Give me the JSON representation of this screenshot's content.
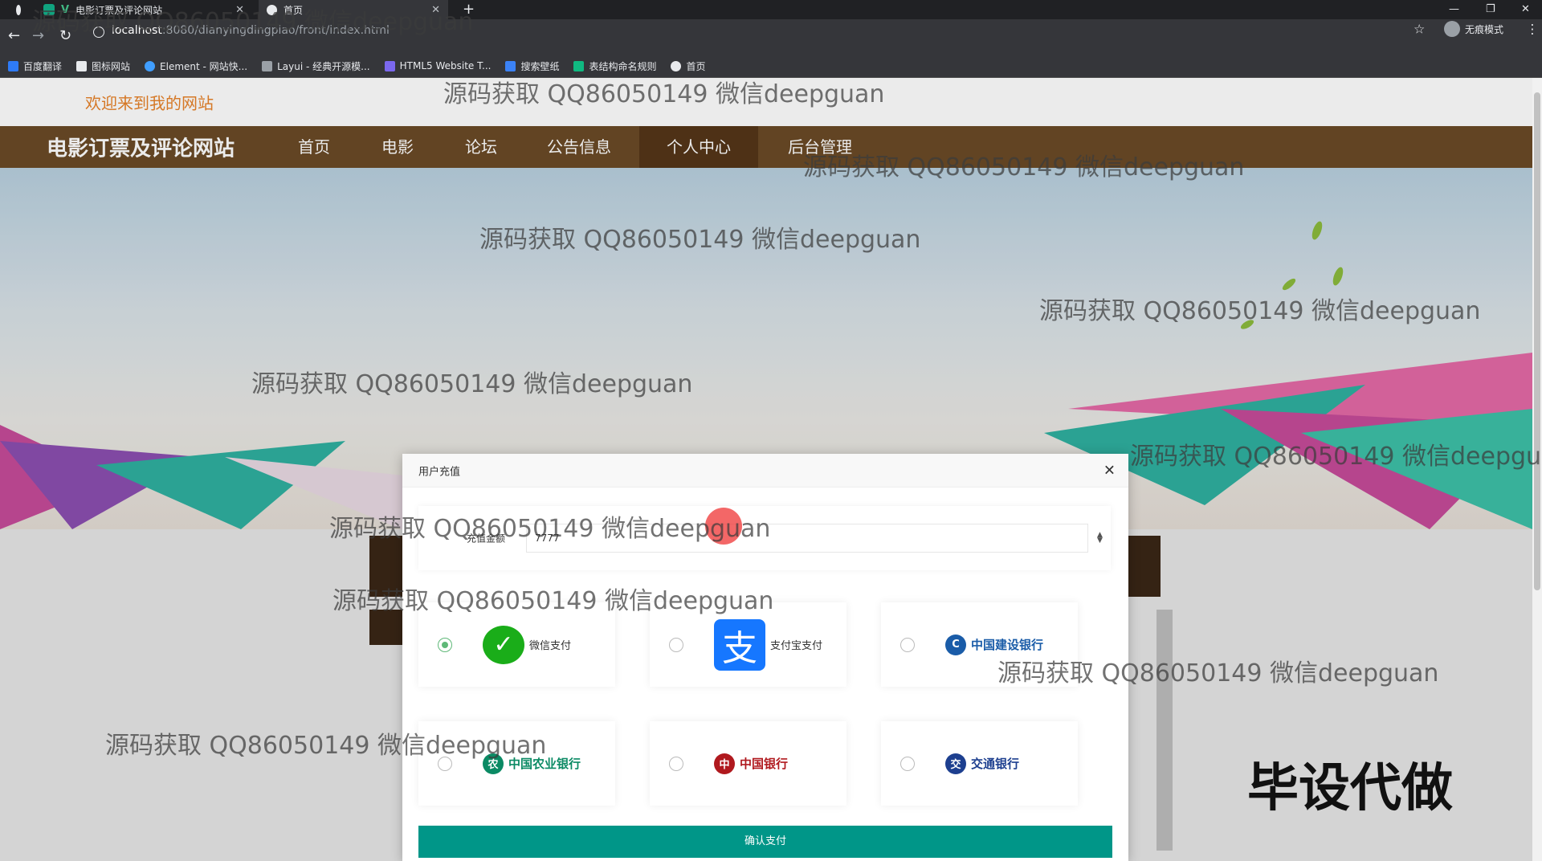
{
  "browser": {
    "tabs": [
      {
        "title": "电影订票及评论网站"
      },
      {
        "title": "首页"
      }
    ],
    "url_host": "localhost",
    "url_path": ":8080/dianyingdingpiao/front/index.html",
    "incognito_label": "无痕模式",
    "bookmarks": [
      "百度翻译",
      "图标网站",
      "Element - 网站快...",
      "Layui - 经典开源模...",
      "HTML5 Website T...",
      "搜索壁纸",
      "表结构命名规则",
      "首页"
    ]
  },
  "site": {
    "welcome": "欢迎来到我的网站",
    "title": "电影订票及评论网站",
    "nav": [
      "首页",
      "电影",
      "论坛",
      "公告信息",
      "个人中心",
      "后台管理"
    ],
    "active_nav": "个人中心"
  },
  "dialog": {
    "title": "用户充值",
    "amount_label": "充值金额",
    "amount_value": "7777",
    "payments": [
      {
        "label": "微信支付",
        "icon": "wechat-pay-icon",
        "selected": true
      },
      {
        "label": "支付宝支付",
        "icon": "alipay-icon",
        "selected": false
      },
      {
        "label": "中国建设银行",
        "icon": "ccb-icon",
        "selected": false
      },
      {
        "label": "中国农业银行",
        "icon": "abc-icon",
        "selected": false
      },
      {
        "label": "中国银行",
        "icon": "boc-icon",
        "selected": false
      },
      {
        "label": "交通银行",
        "icon": "bocom-icon",
        "selected": false
      }
    ],
    "confirm_label": "确认支付"
  },
  "watermark": "源码获取 QQ86050149 微信deepguan",
  "corner_stamp": "毕设代做",
  "colors": {
    "nav_bg": "#6b4a26",
    "welcome": "#e8832a",
    "confirm": "#009688",
    "radio_checked": "#5fb878"
  }
}
